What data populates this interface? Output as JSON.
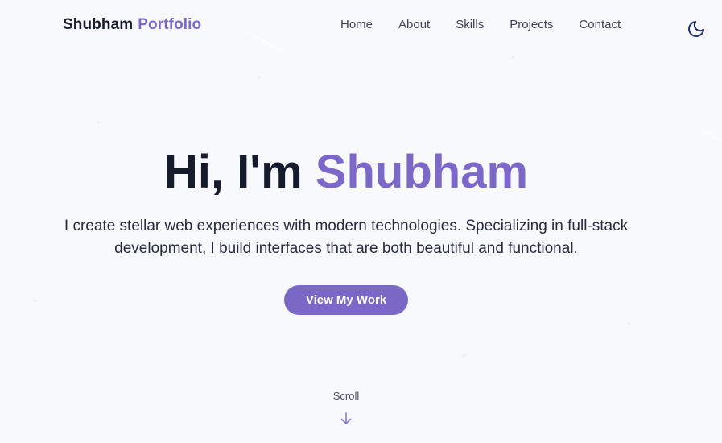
{
  "brand": {
    "first": "Shubham",
    "second": "Portfolio"
  },
  "nav": {
    "items": [
      {
        "label": "Home"
      },
      {
        "label": "About"
      },
      {
        "label": "Skills"
      },
      {
        "label": "Projects"
      },
      {
        "label": "Contact"
      }
    ]
  },
  "theme_toggle": {
    "icon": "moon-icon"
  },
  "hero": {
    "greeting": "Hi, I'm",
    "name": "Shubham",
    "description": "I create stellar web experiences with modern technologies. Specializing in full-stack development, I build interfaces that are both beautiful and functional.",
    "cta_label": "View My Work"
  },
  "scroll": {
    "label": "Scroll",
    "icon": "arrow-down-icon"
  },
  "colors": {
    "accent": "#7c68c8",
    "text_dark": "#161b2e",
    "background": "#f8f9fc",
    "button_bg": "#7a68c6",
    "icon_navy": "#1f2f6b"
  }
}
